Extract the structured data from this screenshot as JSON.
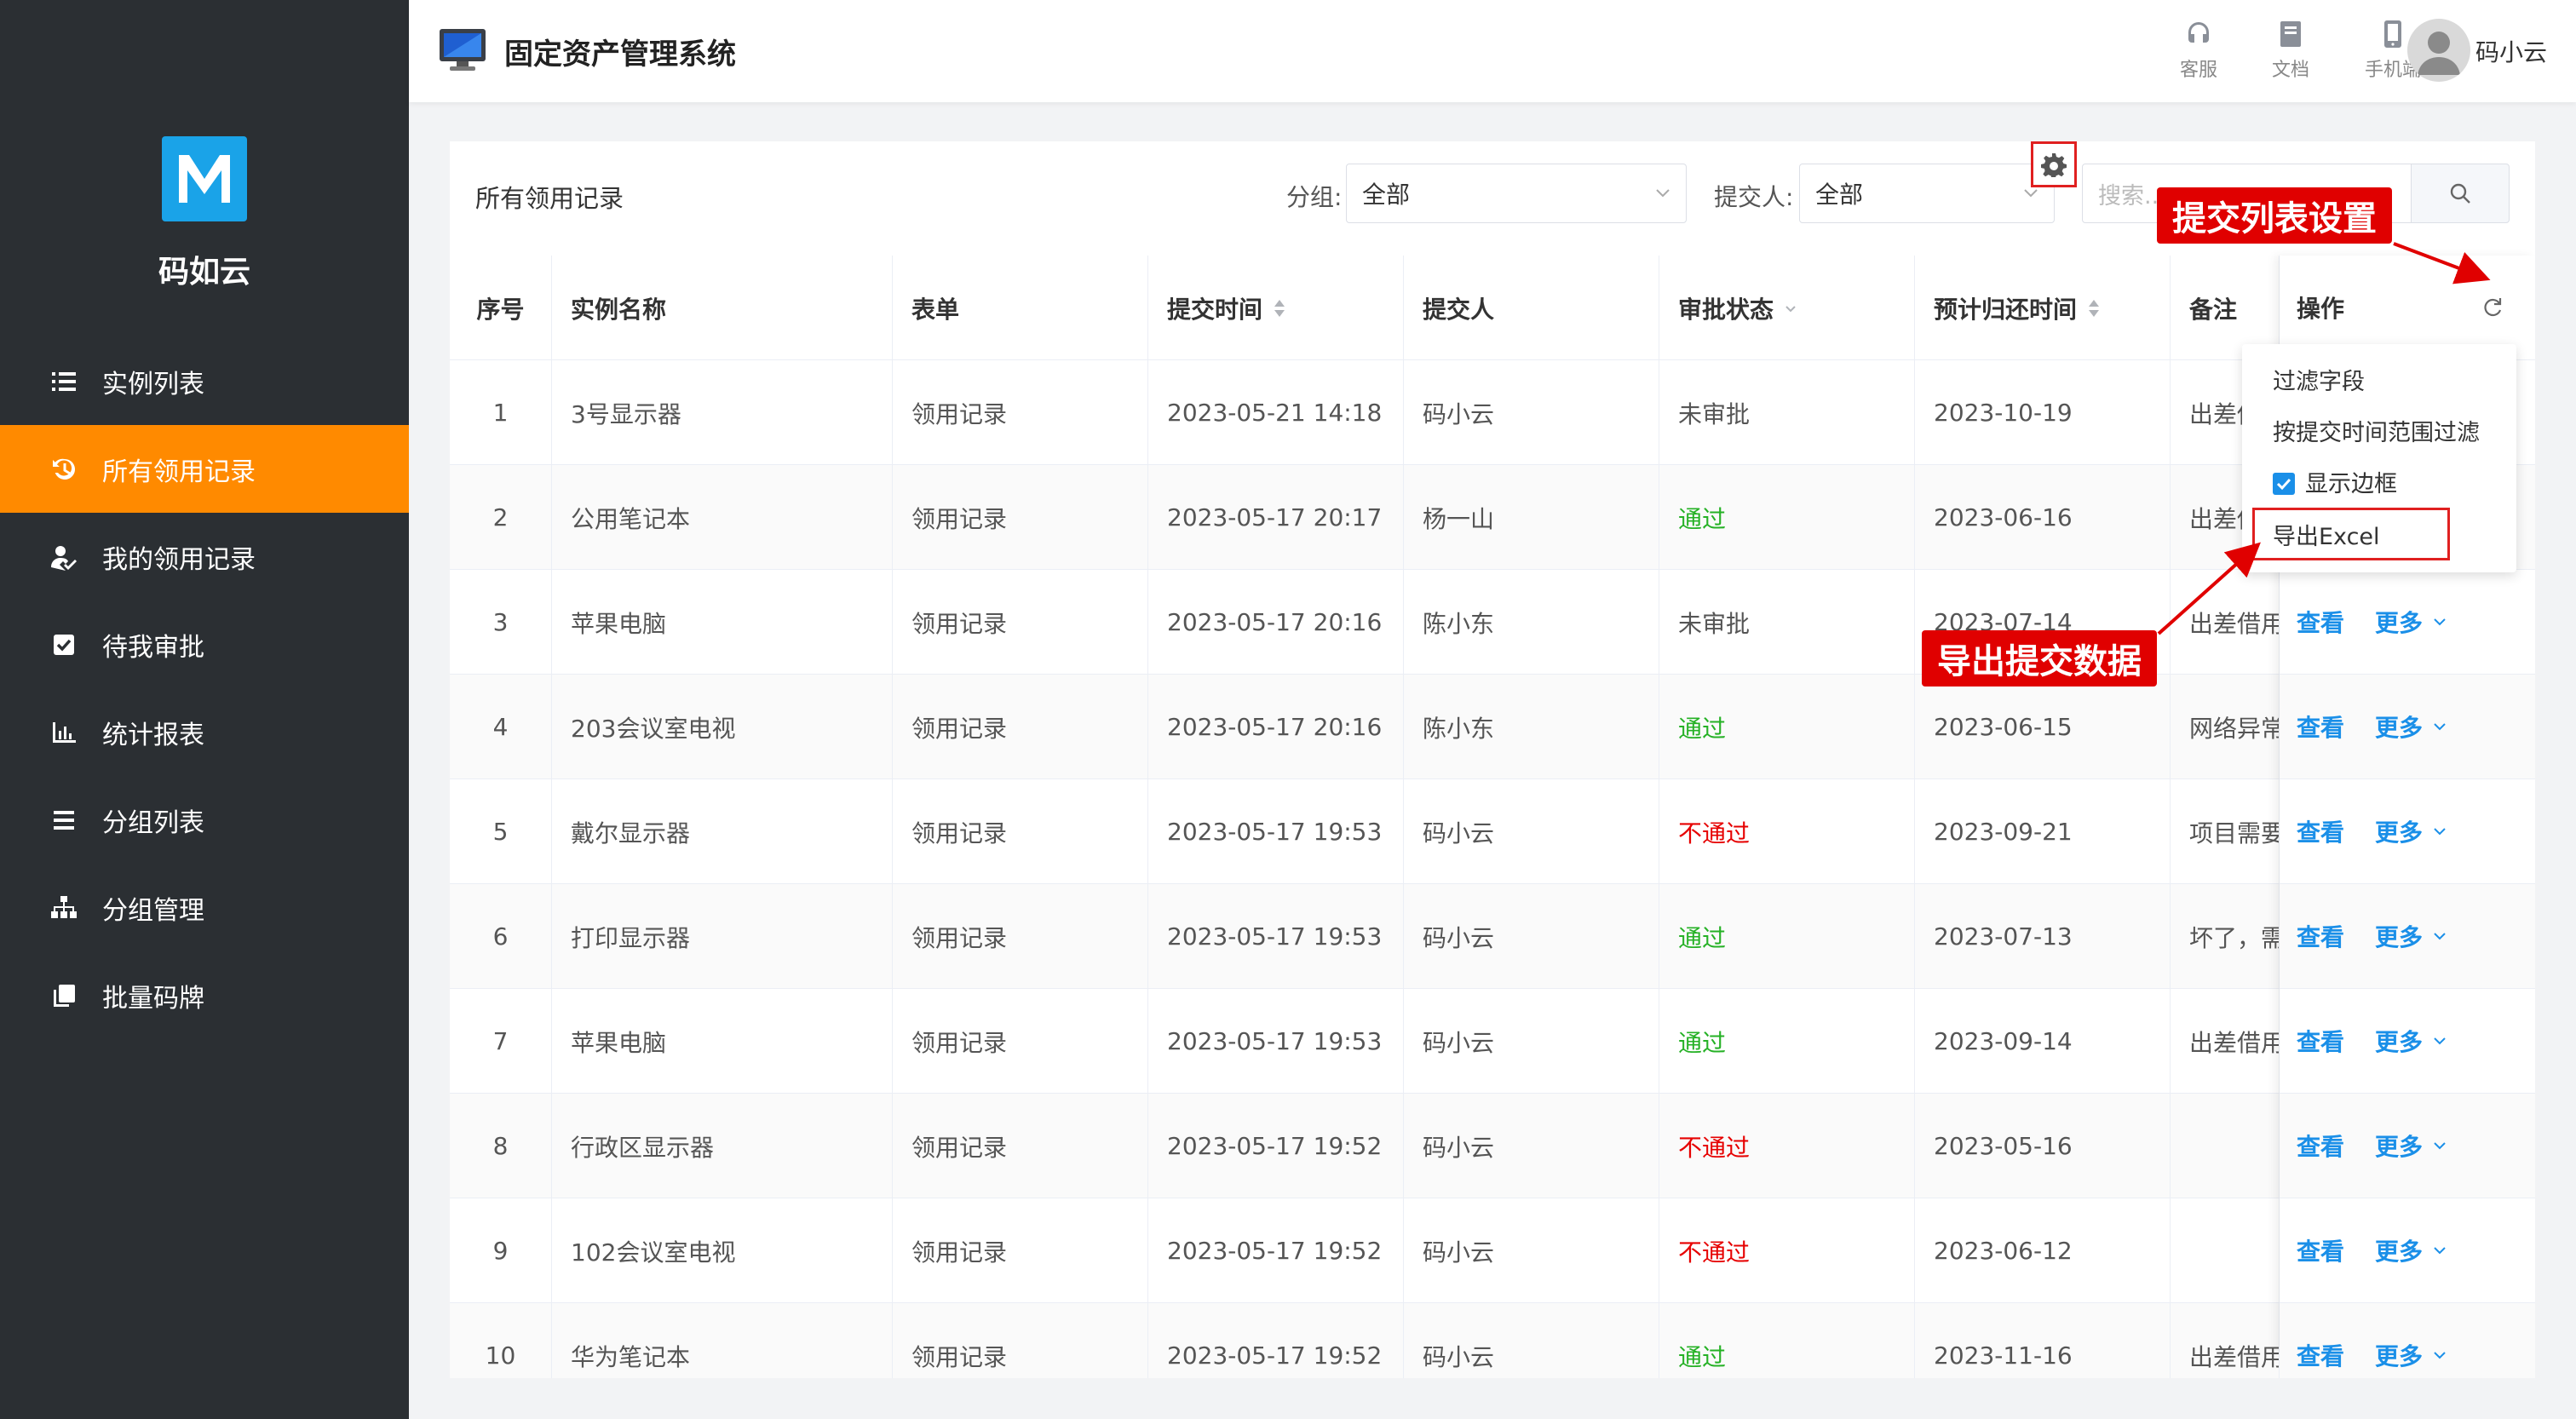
{
  "sidebar": {
    "brand": "码如云",
    "items": [
      {
        "label": "实例列表",
        "icon": "list-icon",
        "active": false
      },
      {
        "label": "所有领用记录",
        "icon": "history-icon",
        "active": true
      },
      {
        "label": "我的领用记录",
        "icon": "user-check-icon",
        "active": false
      },
      {
        "label": "待我审批",
        "icon": "checkbox-icon",
        "active": false
      },
      {
        "label": "统计报表",
        "icon": "bar-chart-icon",
        "active": false
      },
      {
        "label": "分组列表",
        "icon": "menu-lines-icon",
        "active": false
      },
      {
        "label": "分组管理",
        "icon": "org-tree-icon",
        "active": false
      },
      {
        "label": "批量码牌",
        "icon": "copy-icon",
        "active": false
      }
    ]
  },
  "header": {
    "title": "固定资产管理系统",
    "service_label": "客服",
    "docs_label": "文档",
    "mobile_label": "手机端",
    "user_name": "码小云"
  },
  "panel": {
    "title": "所有领用记录",
    "group_label": "分组:",
    "group_value": "全部",
    "submitter_label": "提交人:",
    "submitter_value": "全部",
    "search_placeholder": "搜索..."
  },
  "table": {
    "columns": [
      "序号",
      "实例名称",
      "表单",
      "提交时间",
      "提交人",
      "审批状态",
      "预计归还时间",
      "备注",
      "操作"
    ],
    "rows": [
      {
        "no": "1",
        "name": "3号显示器",
        "form": "领用记录",
        "time": "2023-05-21 14:18",
        "user": "码小云",
        "status": "未审批",
        "status_type": "wait",
        "return": "2023-10-19",
        "note": "出差借用"
      },
      {
        "no": "2",
        "name": "公用笔记本",
        "form": "领用记录",
        "time": "2023-05-17 20:17",
        "user": "杨一山",
        "status": "通过",
        "status_type": "pass",
        "return": "2023-06-16",
        "note": "出差借用"
      },
      {
        "no": "3",
        "name": "苹果电脑",
        "form": "领用记录",
        "time": "2023-05-17 20:16",
        "user": "陈小东",
        "status": "未审批",
        "status_type": "wait",
        "return": "2023-07-14",
        "note": "出差借用"
      },
      {
        "no": "4",
        "name": "203会议室电视",
        "form": "领用记录",
        "time": "2023-05-17 20:16",
        "user": "陈小东",
        "status": "通过",
        "status_type": "pass",
        "return": "2023-06-15",
        "note": "网络异常"
      },
      {
        "no": "5",
        "name": "戴尔显示器",
        "form": "领用记录",
        "time": "2023-05-17 19:53",
        "user": "码小云",
        "status": "不通过",
        "status_type": "fail",
        "return": "2023-09-21",
        "note": "项目需要"
      },
      {
        "no": "6",
        "name": "打印显示器",
        "form": "领用记录",
        "time": "2023-05-17 19:53",
        "user": "码小云",
        "status": "通过",
        "status_type": "pass",
        "return": "2023-07-13",
        "note": "坏了，需"
      },
      {
        "no": "7",
        "name": "苹果电脑",
        "form": "领用记录",
        "time": "2023-05-17 19:53",
        "user": "码小云",
        "status": "通过",
        "status_type": "pass",
        "return": "2023-09-14",
        "note": "出差借用"
      },
      {
        "no": "8",
        "name": "行政区显示器",
        "form": "领用记录",
        "time": "2023-05-17 19:52",
        "user": "码小云",
        "status": "不通过",
        "status_type": "fail",
        "return": "2023-05-16",
        "note": ""
      },
      {
        "no": "9",
        "name": "102会议室电视",
        "form": "领用记录",
        "time": "2023-05-17 19:52",
        "user": "码小云",
        "status": "不通过",
        "status_type": "fail",
        "return": "2023-06-12",
        "note": ""
      },
      {
        "no": "10",
        "name": "华为笔记本",
        "form": "领用记录",
        "time": "2023-05-17 19:52",
        "user": "码小云",
        "status": "通过",
        "status_type": "pass",
        "return": "2023-11-16",
        "note": "出差借用"
      }
    ],
    "view_label": "查看",
    "more_label": "更多"
  },
  "dropdown": {
    "items": [
      "过滤字段",
      "按提交时间范围过滤",
      "显示边框",
      "导出Excel"
    ],
    "show_border_checked": true
  },
  "annotations": {
    "settings_callout": "提交列表设置",
    "export_callout": "导出提交数据"
  },
  "colors": {
    "sidebar_bg": "#2b2f33",
    "accent": "#ff8a00",
    "pass": "#25b125",
    "fail": "#e60000",
    "link": "#1a8fe8",
    "annotation": "#e00000"
  }
}
